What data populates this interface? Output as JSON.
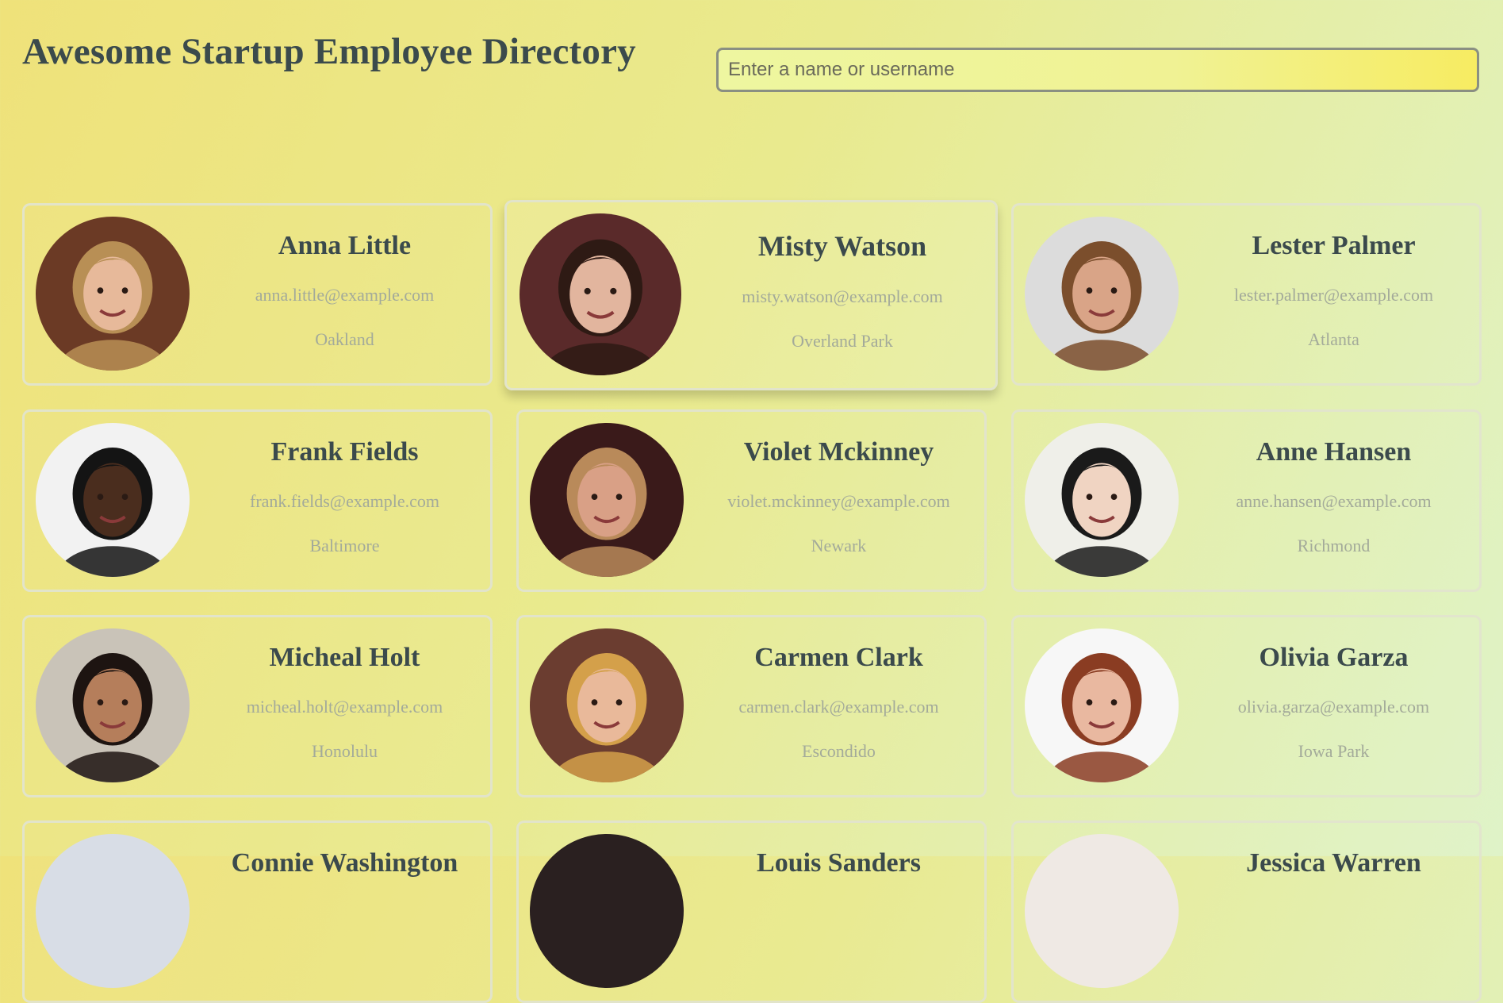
{
  "header": {
    "title": "Awesome Startup Employee Directory",
    "search_placeholder": "Enter a name or username",
    "search_value": ""
  },
  "employees": [
    {
      "name": "Anna Little",
      "email": "anna.little@example.com",
      "city": "Oakland",
      "bg": "#6b3a25",
      "skin": "#e7b99a",
      "hair": "#b88f55"
    },
    {
      "name": "Misty Watson",
      "email": "misty.watson@example.com",
      "city": "Overland Park",
      "bg": "#5a2a2a",
      "skin": "#e2b59e",
      "hair": "#2e1a14"
    },
    {
      "name": "Lester Palmer",
      "email": "lester.palmer@example.com",
      "city": "Atlanta",
      "bg": "#dcdcdc",
      "skin": "#d9a487",
      "hair": "#7b4e2c"
    },
    {
      "name": "Frank Fields",
      "email": "frank.fields@example.com",
      "city": "Baltimore",
      "bg": "#f2f2f2",
      "skin": "#4a2d1e",
      "hair": "#141414"
    },
    {
      "name": "Violet Mckinney",
      "email": "violet.mckinney@example.com",
      "city": "Newark",
      "bg": "#3a1a1a",
      "skin": "#d9a086",
      "hair": "#b98a5a"
    },
    {
      "name": "Anne Hansen",
      "email": "anne.hansen@example.com",
      "city": "Richmond",
      "bg": "#efefe9",
      "skin": "#f0d4c2",
      "hair": "#1a1a1a"
    },
    {
      "name": "Micheal Holt",
      "email": "micheal.holt@example.com",
      "city": "Honolulu",
      "bg": "#c9c3b8",
      "skin": "#b57e5b",
      "hair": "#1d1411"
    },
    {
      "name": "Carmen Clark",
      "email": "carmen.clark@example.com",
      "city": "Escondido",
      "bg": "#6b3d30",
      "skin": "#e9b99a",
      "hair": "#d4a04a"
    },
    {
      "name": "Olivia Garza",
      "email": "olivia.garza@example.com",
      "city": "Iowa Park",
      "bg": "#f7f7f7",
      "skin": "#e9b8a0",
      "hair": "#8a3c22"
    }
  ],
  "partial_row_names": [
    "Connie Washington",
    "Louis Sanders",
    "Jessica Warren"
  ]
}
